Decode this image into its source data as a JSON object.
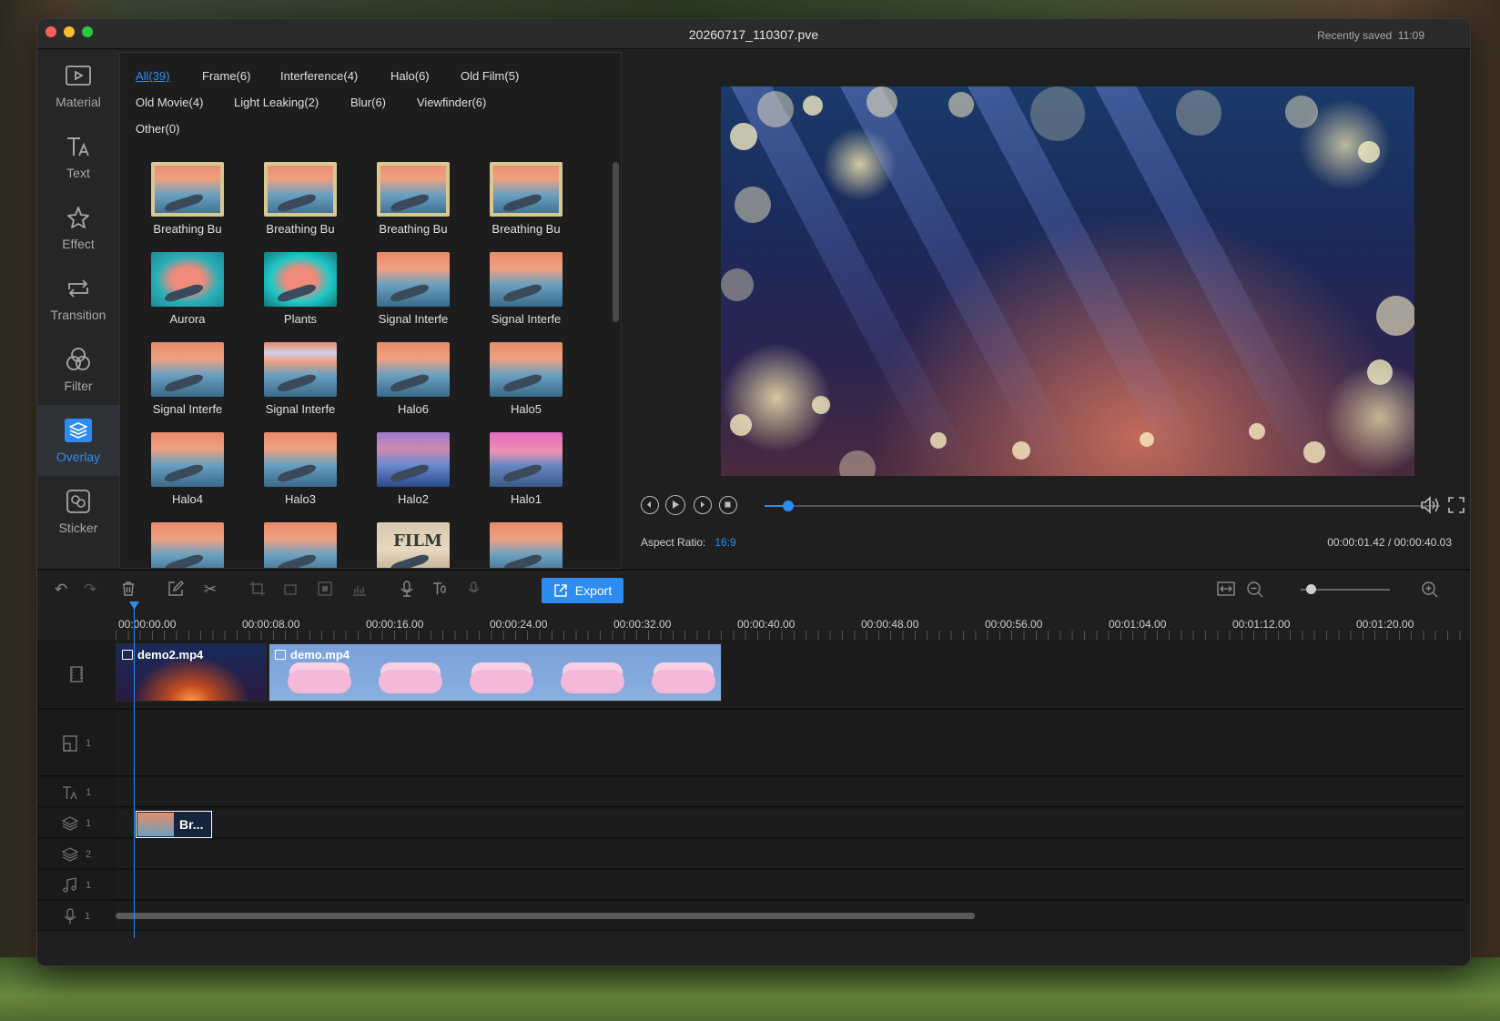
{
  "window": {
    "title": "20260717_110307.pve",
    "saved_label": "Recently saved",
    "saved_time": "11:09"
  },
  "sidebar": {
    "items": [
      {
        "label": "Material",
        "icon": "play-box-icon"
      },
      {
        "label": "Text",
        "icon": "text-icon"
      },
      {
        "label": "Effect",
        "icon": "star-icon"
      },
      {
        "label": "Transition",
        "icon": "transition-icon"
      },
      {
        "label": "Filter",
        "icon": "filter-icon"
      },
      {
        "label": "Overlay",
        "icon": "layers-icon",
        "active": true
      },
      {
        "label": "Sticker",
        "icon": "sticker-icon"
      }
    ]
  },
  "library": {
    "categories": [
      "All(39)",
      "Frame(6)",
      "Interference(4)",
      "Halo(6)",
      "Old Film(5)",
      "Old Movie(4)",
      "Light Leaking(2)",
      "Blur(6)",
      "Viewfinder(6)",
      "Other(0)"
    ],
    "items": [
      "Breathing Bu",
      "Breathing Bu",
      "Breathing Bu",
      "Breathing Bu",
      "Aurora",
      "Plants",
      "Signal Interfe",
      "Signal Interfe",
      "Signal Interfe",
      "Signal Interfe",
      "Halo6",
      "Halo5",
      "Halo4",
      "Halo3",
      "Halo2",
      "Halo1",
      "",
      "",
      "FILM",
      ""
    ]
  },
  "preview": {
    "aspect_label": "Aspect Ratio:",
    "aspect_value": "16:9",
    "current_time": "00:00:01.42",
    "total_time": "/ 00:00:40.03",
    "progress": 0.035
  },
  "toolbar": {
    "export_label": "Export",
    "zoom_level": 0.06
  },
  "timeline": {
    "ruler": [
      "00:00:00.00",
      "00:00:08.00",
      "00:00:16.00",
      "00:00:24.00",
      "00:00:32.00",
      "00:00:40.00",
      "00:00:48.00",
      "00:00:56.00",
      "00:01:04.00",
      "00:01:12.00",
      "00:01:20.00"
    ],
    "clips": [
      "demo2.mp4",
      "demo.mp4"
    ],
    "overlay_clip": "Br...",
    "track_numbers": [
      "1",
      "1",
      "1",
      "2",
      "1",
      "1"
    ]
  }
}
